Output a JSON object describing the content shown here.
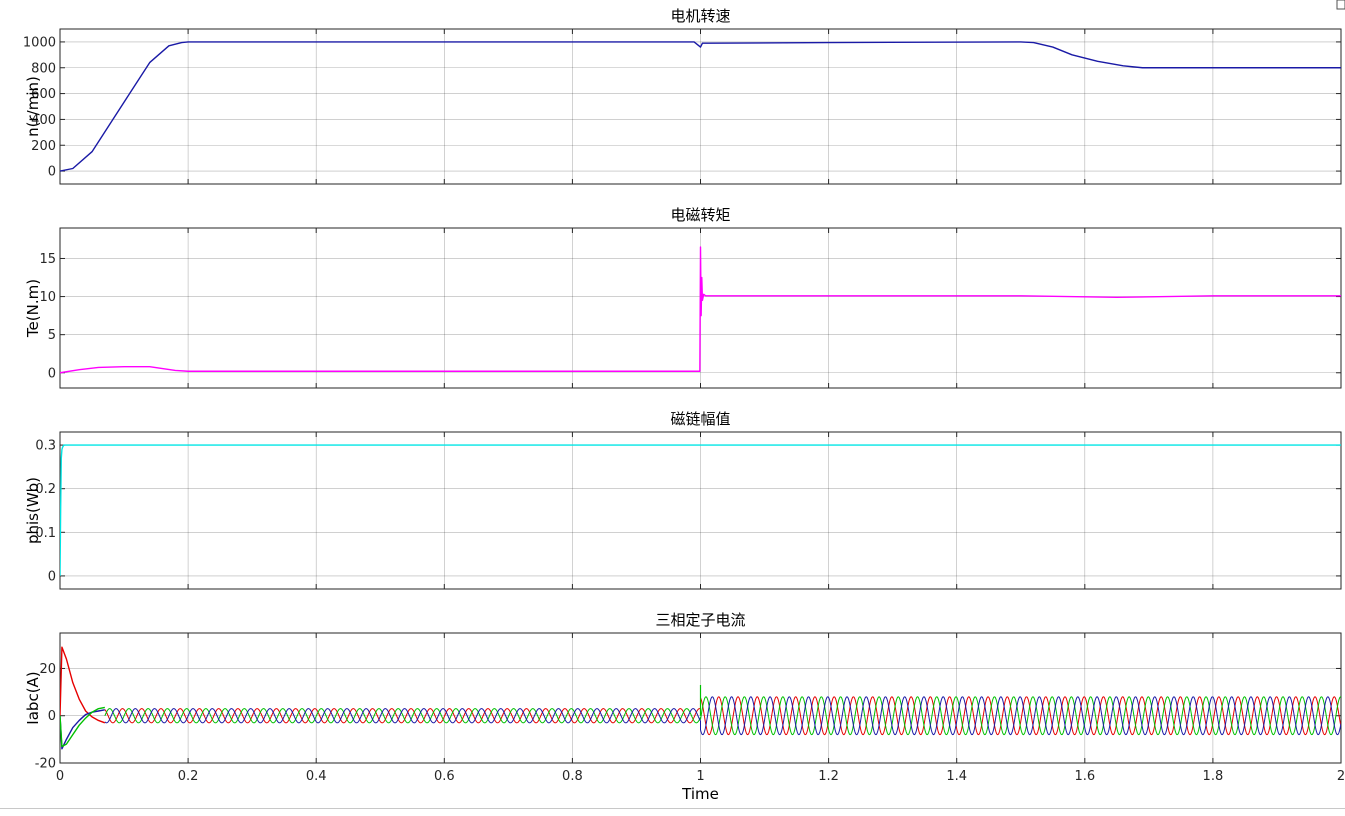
{
  "chart_data": [
    {
      "type": "line",
      "title": "电机转速",
      "ylabel": "n(r/min)",
      "xlabel": "",
      "xlim": [
        0,
        2
      ],
      "ylim": [
        -100,
        1100
      ],
      "yticks": [
        "0",
        "200",
        "400",
        "600",
        "800",
        "1000"
      ],
      "grid": true,
      "series": [
        {
          "color": "#1a1aa6",
          "x": [
            0,
            0.02,
            0.05,
            0.08,
            0.11,
            0.14,
            0.17,
            0.19,
            0.2,
            0.5,
            0.99,
            1.0,
            1.003,
            1.01,
            1.2,
            1.5,
            1.52,
            1.55,
            1.58,
            1.62,
            1.66,
            1.69,
            1.7,
            2.0
          ],
          "y": [
            0,
            20,
            150,
            380,
            610,
            840,
            970,
            995,
            1000,
            1000,
            1000,
            960,
            990,
            990,
            995,
            1000,
            995,
            960,
            900,
            850,
            815,
            800,
            800,
            800
          ]
        }
      ]
    },
    {
      "type": "line",
      "title": "电磁转矩",
      "ylabel": "Te(N.m)",
      "xlabel": "",
      "xlim": [
        0,
        2
      ],
      "ylim": [
        -2,
        19
      ],
      "yticks": [
        "0",
        "5",
        "10",
        "15"
      ],
      "grid": true,
      "series": [
        {
          "color": "#ff00ff",
          "x": [
            0,
            0.03,
            0.06,
            0.1,
            0.14,
            0.18,
            0.2,
            0.5,
            0.999,
            1.0,
            1.001,
            1.002,
            1.003,
            1.005,
            1.008,
            1.2,
            1.5,
            1.65,
            1.8,
            2.0
          ],
          "y": [
            0,
            0.4,
            0.7,
            0.8,
            0.8,
            0.3,
            0.2,
            0.2,
            0.2,
            16.5,
            7.5,
            12.5,
            9.5,
            10.3,
            10.1,
            10.1,
            10.1,
            9.9,
            10.1,
            10.1
          ]
        }
      ]
    },
    {
      "type": "line",
      "title": "磁链幅值",
      "ylabel": "phis(Wb)",
      "xlabel": "",
      "xlim": [
        0,
        2
      ],
      "ylim": [
        -0.03,
        0.33
      ],
      "yticks": [
        "0",
        "0.1",
        "0.2",
        "0.3"
      ],
      "grid": true,
      "series": [
        {
          "color": "#00e5e5",
          "x": [
            0,
            0.001,
            0.002,
            0.003,
            0.004,
            0.006,
            0.01,
            0.5,
            1.0,
            1.5,
            2.0
          ],
          "y": [
            0,
            0.15,
            0.27,
            0.29,
            0.295,
            0.3,
            0.3,
            0.3,
            0.3,
            0.3,
            0.3
          ]
        }
      ]
    },
    {
      "type": "line",
      "title": "三相定子电流",
      "ylabel": "Iabc(A)",
      "xlabel": "Time",
      "xlim": [
        0,
        2
      ],
      "ylim": [
        -20,
        35
      ],
      "yticks": [
        "-20",
        "0",
        "20"
      ],
      "xticks": [
        "0",
        "0.2",
        "0.4",
        "0.6",
        "0.8",
        "1",
        "1.2",
        "1.4",
        "1.6",
        "1.8",
        "2"
      ],
      "grid": true,
      "series": [
        {
          "color": "#e60000",
          "x": [
            0,
            0.003,
            0.01,
            0.02,
            0.03,
            0.04,
            0.05,
            0.06,
            0.07
          ],
          "y": [
            0,
            29,
            24,
            14,
            7,
            2,
            -0.5,
            -2,
            -3
          ]
        },
        {
          "color": "#1a1aa6",
          "x": [
            0,
            0.003,
            0.01,
            0.02,
            0.03,
            0.04,
            0.05,
            0.06,
            0.07
          ],
          "y": [
            0,
            -14,
            -10,
            -5,
            -2,
            0.5,
            1.5,
            2,
            2.5
          ]
        },
        {
          "color": "#00c000",
          "x": [
            0,
            0.003,
            0.01,
            0.02,
            0.03,
            0.04,
            0.05,
            0.06,
            0.07
          ],
          "y": [
            0,
            -13,
            -12,
            -8,
            -4,
            -1,
            1.5,
            3,
            3.5
          ]
        }
      ],
      "oscillation": {
        "colors": [
          "#e60000",
          "#00c000",
          "#1a1aa6"
        ],
        "segments": [
          {
            "x_start": 0.07,
            "x_end": 1.0,
            "amplitude": 3,
            "frequency_hz": 33.3
          },
          {
            "x_start": 1.0,
            "x_end": 2.0,
            "amplitude": 8,
            "frequency_hz": 33.3
          }
        ],
        "spike": {
          "x": 1.0,
          "y": 13
        }
      }
    }
  ]
}
